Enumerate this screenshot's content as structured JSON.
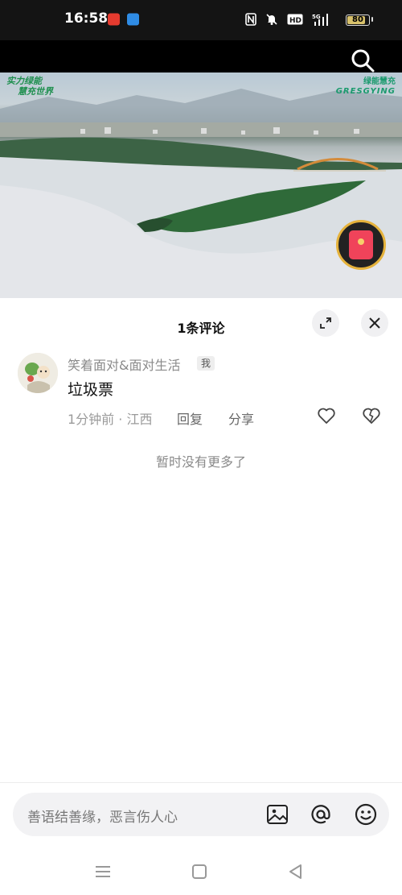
{
  "status_bar": {
    "time": "16:58",
    "battery_percent": "80",
    "battery_level": 0.8,
    "icons": [
      "nfc-icon",
      "mute-icon",
      "hd-icon",
      "5g-signal-icon"
    ]
  },
  "video": {
    "brand_left_line1": "实力绿能",
    "brand_left_line2": "慧充世界",
    "brand_right_line1": "绿能慧充",
    "brand_right_line2": "GRESGYING"
  },
  "comments": {
    "title": "1条评论",
    "items": [
      {
        "username": "笑着面对&面对生活",
        "tag": "我",
        "text": "垃圾票",
        "meta": "1分钟前 · 江西",
        "reply": "回复",
        "share": "分享"
      }
    ],
    "no_more": "暂时没有更多了"
  },
  "input": {
    "placeholder": "善语结善缘，恶言伤人心"
  },
  "colors": {
    "accent_red": "#f0435a",
    "ring_gold": "#e5b23b",
    "brand_green": "#1e8f4e"
  }
}
